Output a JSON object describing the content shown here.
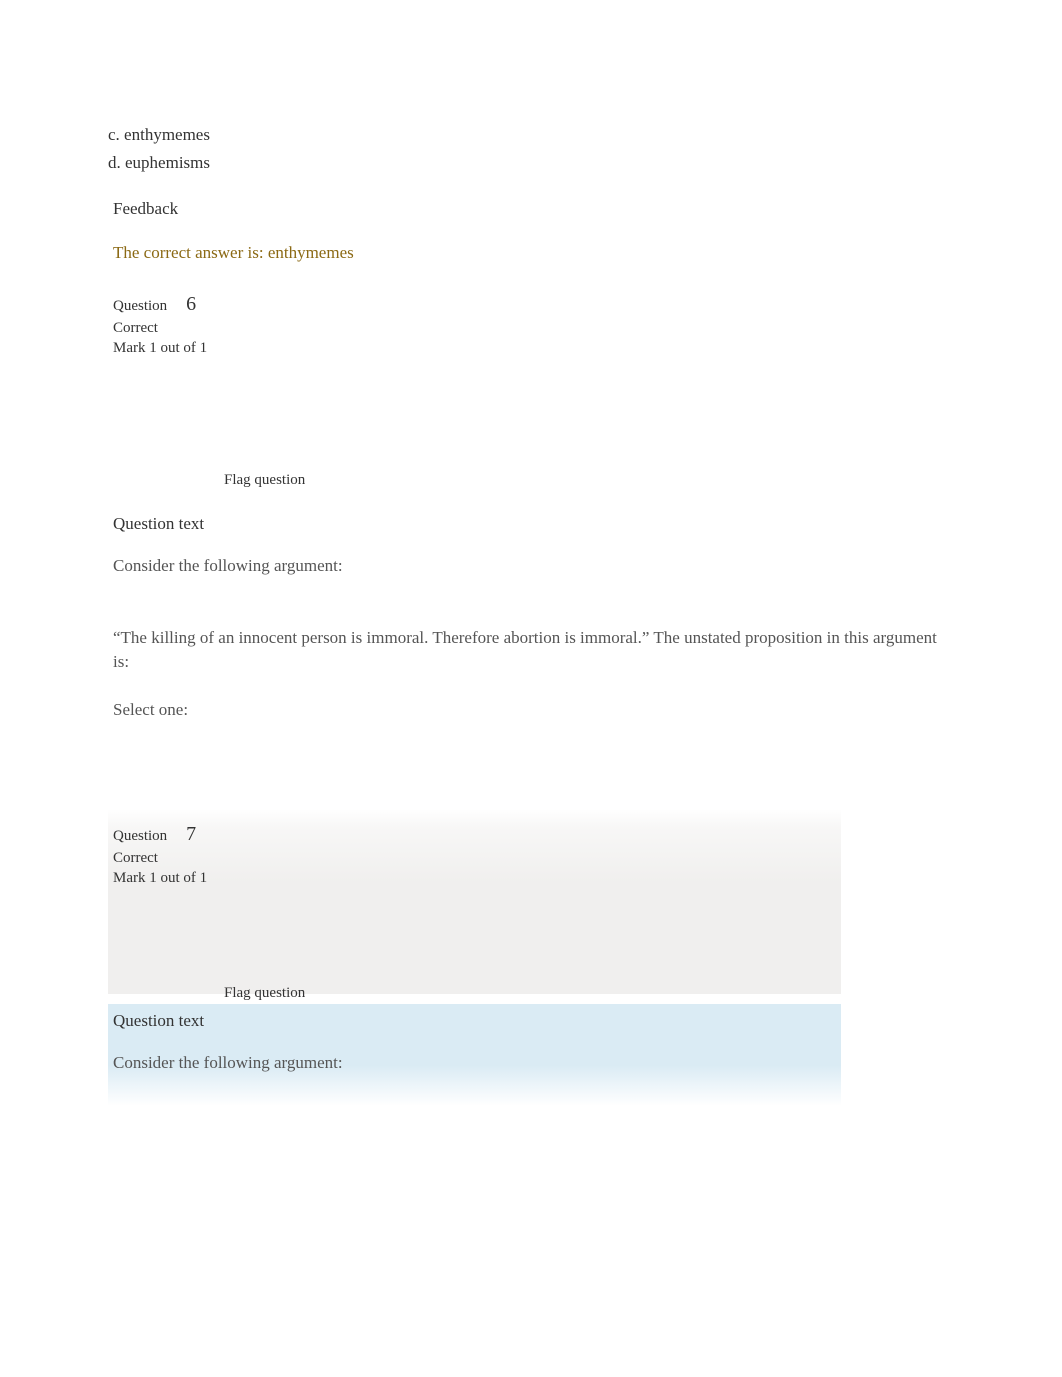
{
  "q5": {
    "options": {
      "c": "c. enthymemes",
      "d": "d. euphemisms"
    },
    "feedback_heading": "Feedback",
    "feedback_text": "The correct answer is: enthymemes"
  },
  "q6": {
    "label": "Question",
    "number": "6",
    "status": "Correct",
    "mark": "Mark 1 out of 1",
    "flag": "Flag question",
    "question_text_heading": "Question text",
    "intro": "Consider the following argument:",
    "body": "“The killing of an innocent person is immoral. Therefore abortion is immoral.” The unstated proposition in this argument is:",
    "select_one": "Select one:"
  },
  "q7": {
    "label": "Question",
    "number": "7",
    "status": "Correct",
    "mark": "Mark 1 out of 1",
    "flag": "Flag question",
    "question_text_heading": "Question text",
    "intro": "Consider the following argument:"
  }
}
